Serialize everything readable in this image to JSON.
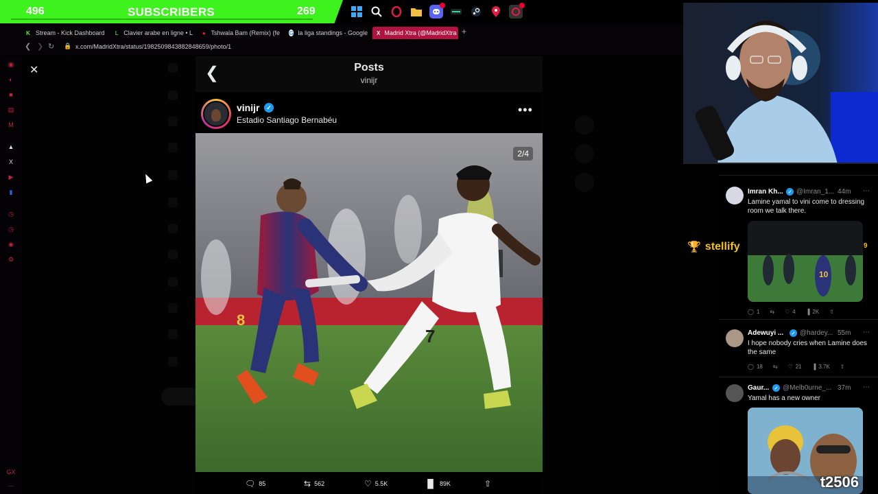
{
  "subscriber_banner": {
    "count_left": "496",
    "label": "SUBSCRIBERS",
    "count_right": "269"
  },
  "taskbar": {
    "icons": [
      "windows-icon",
      "search-icon",
      "opera-gx-icon",
      "file-explorer-icon",
      "discord-icon",
      "app-icon",
      "steam-icon",
      "maps-pin-icon",
      "opera-icon"
    ],
    "discord_badge": "9+"
  },
  "browser": {
    "tabs": [
      {
        "label": "Stream - Kick Dashboard",
        "favicon": "K",
        "color": "#53fc18"
      },
      {
        "label": "Clavier arabe en ligne • L",
        "favicon": "L",
        "color": "#46b93a"
      },
      {
        "label": "Tshwala Bam (Remix) (fe",
        "favicon": "●",
        "color": "#e21d3f"
      },
      {
        "label": "la liga standings - Google",
        "favicon": "G",
        "color": "#4285f4"
      },
      {
        "label": "Madrid Xtra (@MadridXtra",
        "favicon": "X",
        "color": "#ffffff"
      }
    ],
    "new_tab": "+",
    "url": "x.com/MadridXtra/status/1982509843882848659/photo/1"
  },
  "post": {
    "title": "Posts",
    "subtitle": "vinijr",
    "author": "vinijr",
    "location": "Estadio Santiago Bernabéu",
    "photo_counter": "2/4",
    "actions": {
      "replies": "85",
      "reposts": "562",
      "likes": "5.5K",
      "views": "89K"
    }
  },
  "replies": [
    {
      "name": "Imran Kh...",
      "handle": "@Imran_1...",
      "time": "44m",
      "text": "Lamine yamal to vini come to dressing room we talk there.",
      "stats": {
        "replies": "1",
        "likes": "4",
        "views": "2K"
      }
    },
    {
      "name": "Adewuyi ...",
      "handle": "@hardey...",
      "time": "55m",
      "text": "I hope nobody cries when Lamine does the same",
      "stats": {
        "replies": "18",
        "likes": "21",
        "views": "3.7K"
      }
    },
    {
      "name": "Gaur...",
      "handle": "@Melb0urne_...",
      "time": "37m",
      "text": "Yamal has a new owner",
      "image_watermark": "t2506"
    }
  ],
  "overlay": {
    "brand": "stellify",
    "count": "9"
  },
  "colors": {
    "banner_green": "#3ef21d",
    "opera_red": "#e21d3f",
    "x_verified_blue": "#1d9bf0",
    "active_tab": "#b1123f",
    "stellify_gold": "#f5c31a"
  }
}
